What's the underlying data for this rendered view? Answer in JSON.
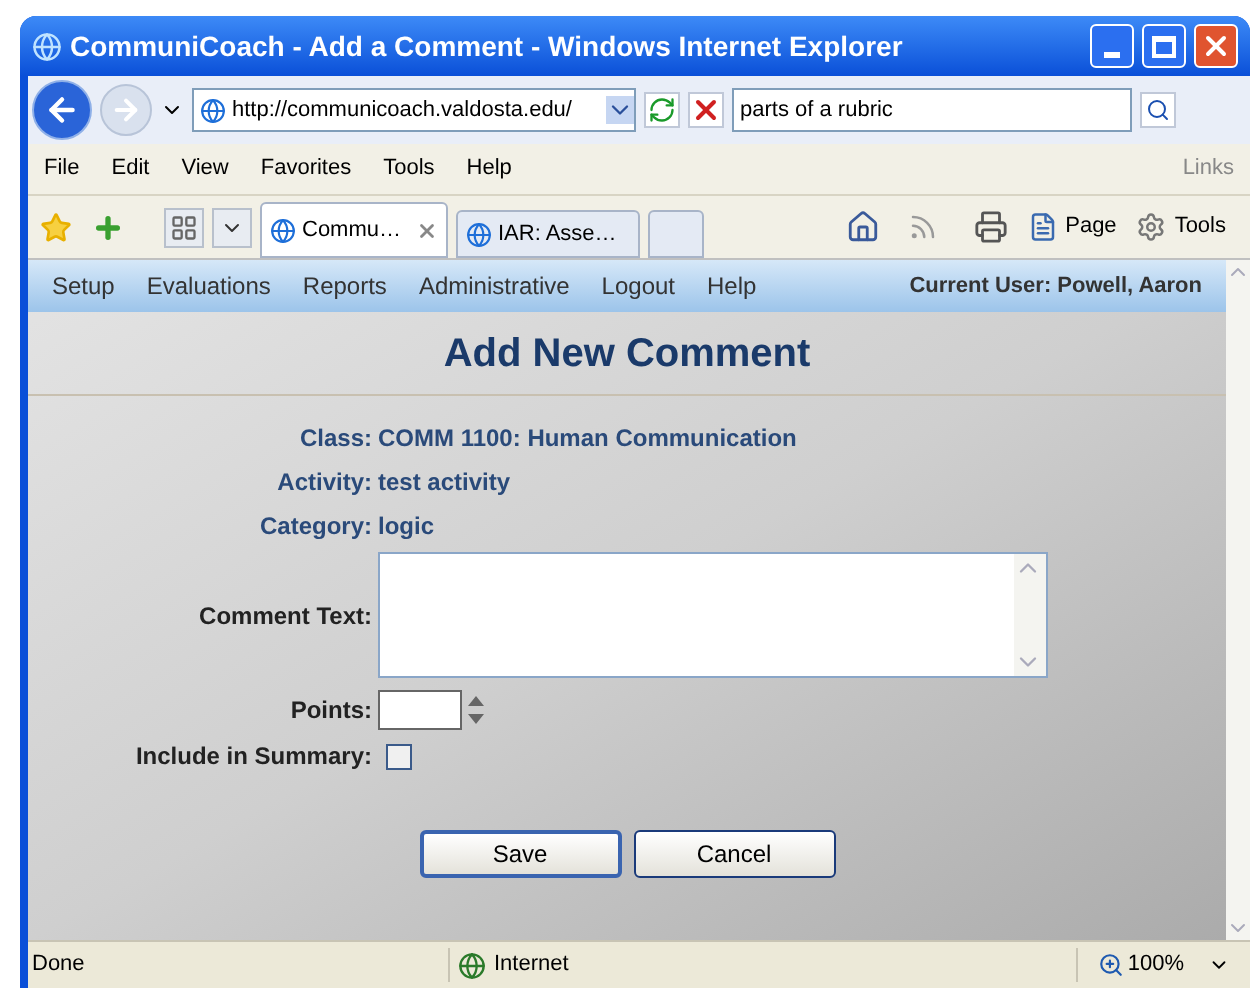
{
  "window": {
    "title": "CommuniCoach - Add a Comment - Windows Internet Explorer"
  },
  "address_bar": {
    "value": "http://communicoach.valdosta.edu/"
  },
  "search": {
    "value": "parts of a rubric"
  },
  "menu": [
    "File",
    "Edit",
    "View",
    "Favorites",
    "Tools",
    "Help"
  ],
  "links_label": "Links",
  "tabs": [
    {
      "label": "Commu…",
      "selected": true
    },
    {
      "label": "IAR: Asse…",
      "selected": false
    }
  ],
  "command_bar": [
    "Page",
    "Tools"
  ],
  "nav": [
    "Setup",
    "Evaluations",
    "Reports",
    "Administrative",
    "Logout",
    "Help"
  ],
  "current_user": "Current User: Powell, Aaron",
  "heading": "Add New Comment",
  "details": [
    {
      "label": "Class:",
      "value": "COMM 1100: Human Communication"
    },
    {
      "label": "Activity:",
      "value": "test activity"
    },
    {
      "label": "Category:",
      "value": "logic"
    }
  ],
  "form": {
    "comment_label": "Comment Text:",
    "points_label": "Points:",
    "summary_label": "Include in Summary:",
    "include_in_summary": false
  },
  "buttons": [
    "Save",
    "Cancel"
  ],
  "status_bar": {
    "text": "Done",
    "zone": "Internet",
    "zoom": "100%"
  }
}
